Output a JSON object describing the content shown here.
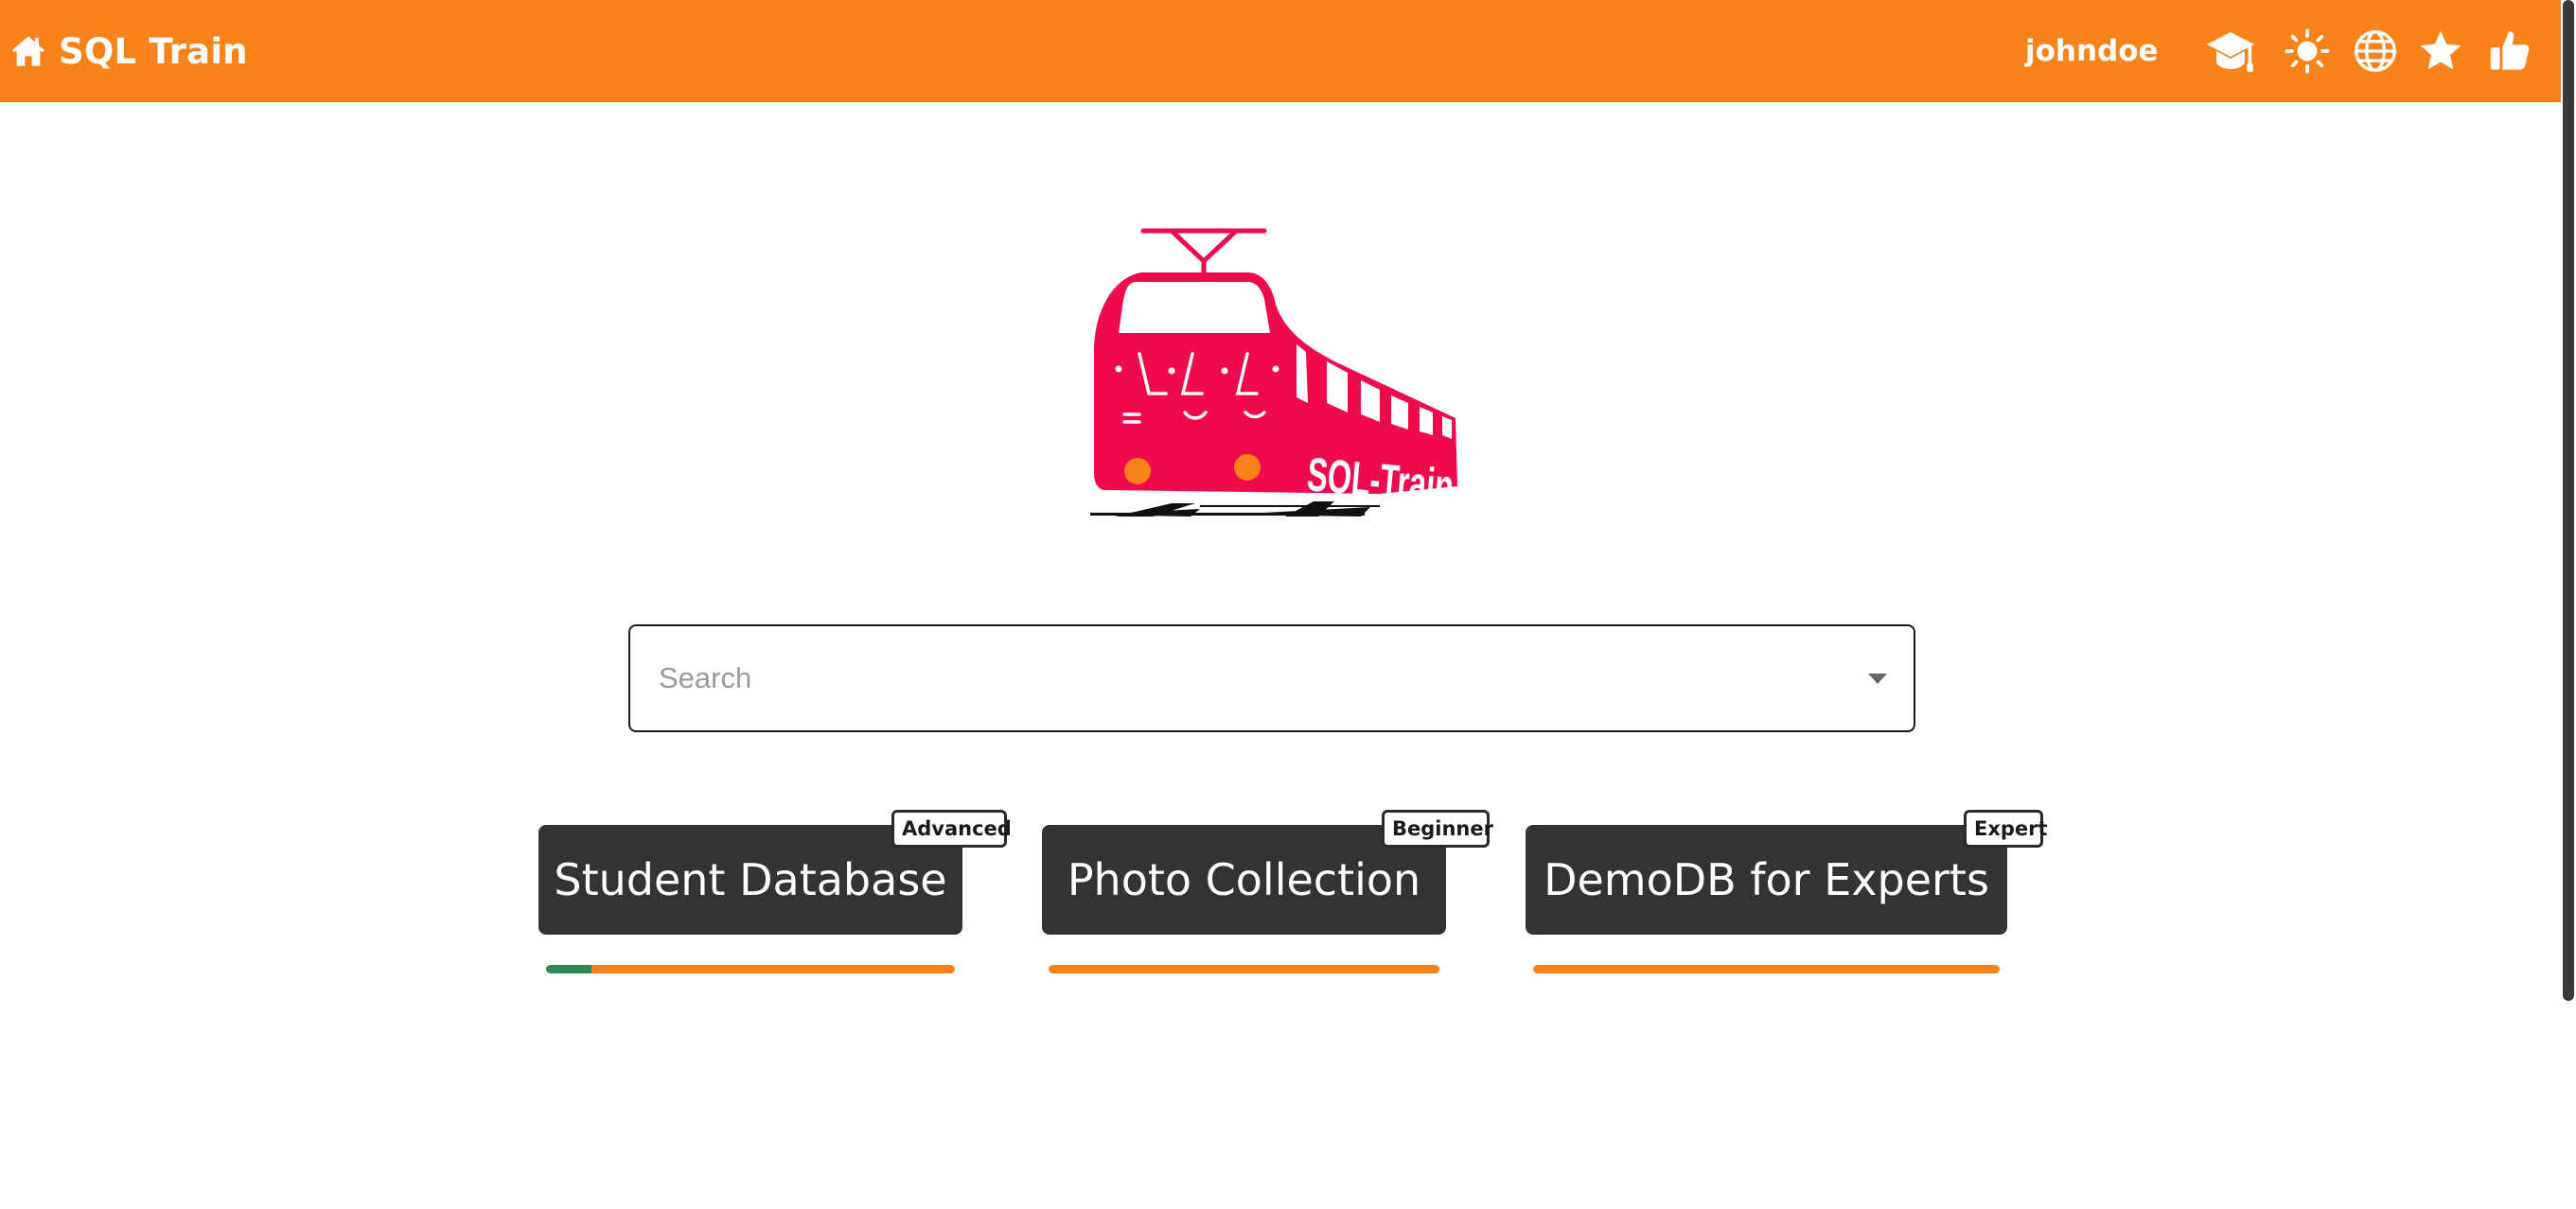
{
  "header": {
    "title": "SQL Train",
    "username": "johndoe",
    "icons": [
      "home-icon",
      "graduation-cap-icon",
      "sun-icon",
      "globe-icon",
      "star-icon",
      "thumbs-up-icon"
    ]
  },
  "logo": {
    "text": "SQL-Train"
  },
  "search": {
    "placeholder": "Search",
    "value": ""
  },
  "databases": [
    {
      "name": "Student Database",
      "level": "Advanced",
      "progress": 0.11
    },
    {
      "name": "Photo Collection",
      "level": "Beginner",
      "progress": 0.0
    },
    {
      "name": "DemoDB for Experts",
      "level": "Expert",
      "progress": 0.0
    }
  ],
  "colors": {
    "header": "#f8831a",
    "accent": "#f8831a",
    "card": "#333333",
    "progress_done": "#2e8b57",
    "logo": "#ee0a4c",
    "logo_lights": "#f8831a"
  }
}
